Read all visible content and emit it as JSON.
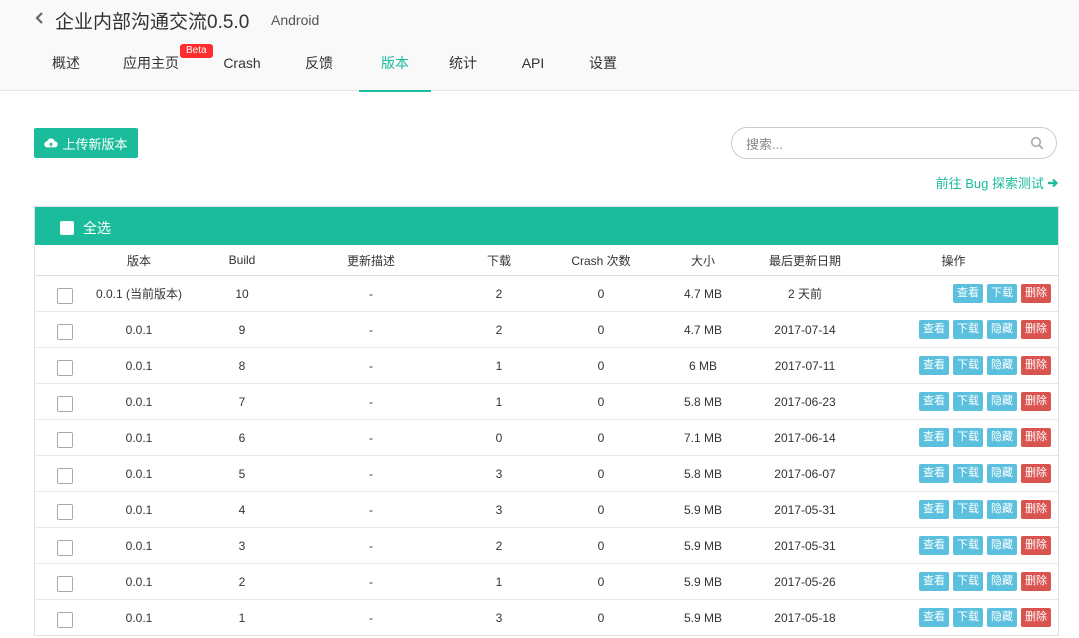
{
  "header": {
    "app_title": "企业内部沟通交流0.5.0",
    "platform": "Android",
    "beta_badge": "Beta",
    "tabs": [
      {
        "label": "概述"
      },
      {
        "label": "应用主页"
      },
      {
        "label": "Crash"
      },
      {
        "label": "反馈"
      },
      {
        "label": "版本",
        "active": true
      },
      {
        "label": "统计"
      },
      {
        "label": "API"
      },
      {
        "label": "设置"
      }
    ]
  },
  "toolbar": {
    "upload_label": "上传新版本",
    "search_placeholder": "搜索...",
    "bug_link_label": "前往 Bug 探索测试"
  },
  "table": {
    "select_all_label": "全选",
    "headers": [
      "版本",
      "Build",
      "更新描述",
      "下载",
      "Crash 次数",
      "大小",
      "最后更新日期",
      "操作"
    ],
    "action_labels": {
      "view": "查看",
      "download": "下载",
      "hide": "隐藏",
      "delete": "删除"
    },
    "rows": [
      {
        "version": "0.0.1 (当前版本)",
        "build": "10",
        "desc": "-",
        "downloads": "2",
        "crashes": "0",
        "size": "4.7 MB",
        "date": "2 天前",
        "current": true
      },
      {
        "version": "0.0.1",
        "build": "9",
        "desc": "-",
        "downloads": "2",
        "crashes": "0",
        "size": "4.7 MB",
        "date": "2017-07-14"
      },
      {
        "version": "0.0.1",
        "build": "8",
        "desc": "-",
        "downloads": "1",
        "crashes": "0",
        "size": "6 MB",
        "date": "2017-07-11"
      },
      {
        "version": "0.0.1",
        "build": "7",
        "desc": "-",
        "downloads": "1",
        "crashes": "0",
        "size": "5.8 MB",
        "date": "2017-06-23"
      },
      {
        "version": "0.0.1",
        "build": "6",
        "desc": "-",
        "downloads": "0",
        "crashes": "0",
        "size": "7.1 MB",
        "date": "2017-06-14"
      },
      {
        "version": "0.0.1",
        "build": "5",
        "desc": "-",
        "downloads": "3",
        "crashes": "0",
        "size": "5.8 MB",
        "date": "2017-06-07"
      },
      {
        "version": "0.0.1",
        "build": "4",
        "desc": "-",
        "downloads": "3",
        "crashes": "0",
        "size": "5.9 MB",
        "date": "2017-05-31"
      },
      {
        "version": "0.0.1",
        "build": "3",
        "desc": "-",
        "downloads": "2",
        "crashes": "0",
        "size": "5.9 MB",
        "date": "2017-05-31"
      },
      {
        "version": "0.0.1",
        "build": "2",
        "desc": "-",
        "downloads": "1",
        "crashes": "0",
        "size": "5.9 MB",
        "date": "2017-05-26"
      },
      {
        "version": "0.0.1",
        "build": "1",
        "desc": "-",
        "downloads": "3",
        "crashes": "0",
        "size": "5.9 MB",
        "date": "2017-05-18"
      }
    ]
  },
  "icons": {
    "back": "chevron-left-icon",
    "upload": "cloud-upload-icon",
    "search": "search-icon",
    "arrow": "arrow-right-icon"
  },
  "colors": {
    "accent": "#1abc9c",
    "info": "#5bc0de",
    "danger": "#d9534f",
    "badge": "#ff2d2d"
  }
}
